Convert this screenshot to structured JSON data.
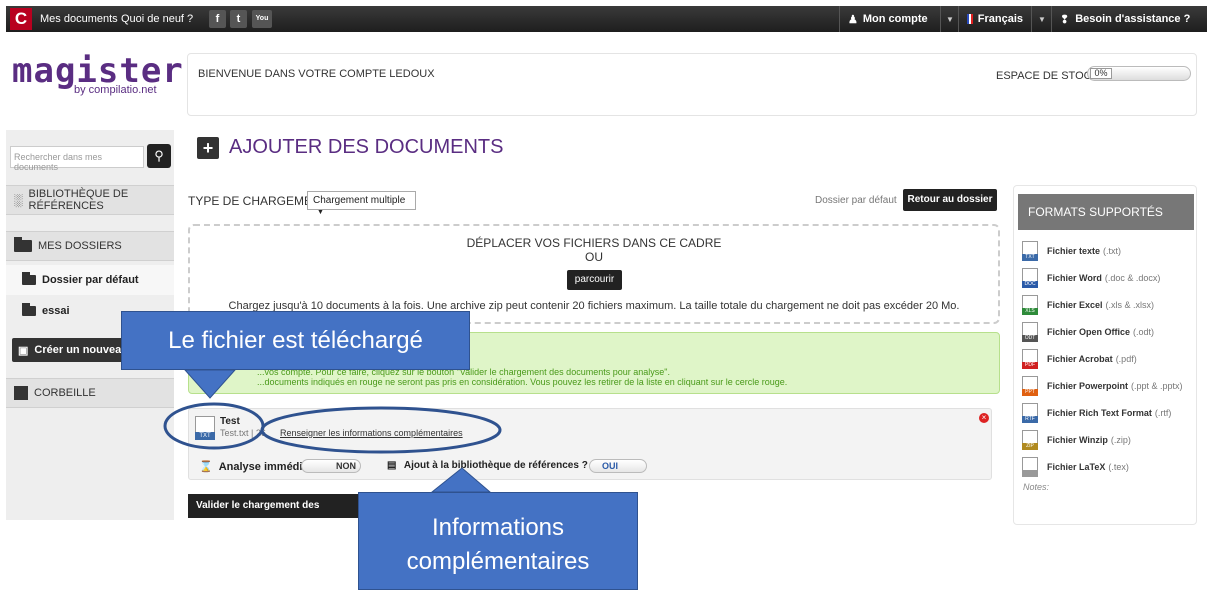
{
  "topbar": {
    "logo_letter": "C",
    "nav": [
      "Mes documents",
      "Quoi de neuf ?"
    ],
    "social": [
      "f",
      "t",
      "You"
    ],
    "account": "Mon compte",
    "language": "Français",
    "help": "Besoin d'assistance ?"
  },
  "brand": {
    "name": "magister",
    "by": "by compilatio.net"
  },
  "welcome": {
    "text": "BIENVENUE DANS VOTRE COMPTE LEDOUX",
    "storage_label": "ESPACE DE STOCKAGE",
    "storage_value": "0%",
    "storage_used": 0
  },
  "sidebar": {
    "search_placeholder": "Rechercher dans mes documents",
    "library": "BIBLIOTHÈQUE DE RÉFÉRENCES",
    "folders_header": "MES DOSSIERS",
    "folders": [
      "Dossier par défaut",
      "essai"
    ],
    "create_button": "Créer un nouveau",
    "trash": "CORBEILLE"
  },
  "main": {
    "title": "AJOUTER DES DOCUMENTS",
    "type_label": "TYPE DE CHARGEMENT",
    "type_value": "Chargement multiple",
    "default_folder": "Dossier par défaut",
    "back_button": "Retour au dossier",
    "dropzone": {
      "line1": "DÉPLACER VOS FICHIERS DANS CE CADRE",
      "line2": "OU",
      "browse": "parcourir",
      "line3": "Chargez jusqu'à 10 documents à la fois. Une archive zip peut contenir 20 fichiers maximum. La taille totale du chargement ne doit pas excéder 20 Mo."
    },
    "notice": {
      "line1": "...vos compte. Pour ce faire, cliquez sur le bouton \"Valider le chargement des documents pour analyse\".",
      "line2": "...documents indiqués en rouge ne seront pas pris en considération. Vous pouvez les retirer de la liste en cliquant sur le cercle rouge."
    },
    "file": {
      "name": "Test",
      "ext_label": "TXT",
      "meta": "Test.txt | 26",
      "link": "Renseigner les informations complémentaires",
      "analyse_label": "Analyse immédiate",
      "analyse_state": "NON",
      "library_label": "Ajout à la bibliothèque de références ?",
      "library_state": "OUI"
    },
    "validate_button": "Valider le chargement des documents"
  },
  "formats": {
    "header": "FORMATS SUPPORTÉS",
    "items": [
      {
        "name": "Fichier texte",
        "ext": "(.txt)",
        "tag": "TXT",
        "color": "#3b6aa8"
      },
      {
        "name": "Fichier Word",
        "ext": "(.doc & .docx)",
        "tag": "DOC",
        "color": "#2a5aa8"
      },
      {
        "name": "Fichier Excel",
        "ext": "(.xls & .xlsx)",
        "tag": "XLS",
        "color": "#2e8b3a"
      },
      {
        "name": "Fichier Open Office",
        "ext": "(.odt)",
        "tag": "ODT",
        "color": "#555555"
      },
      {
        "name": "Fichier Acrobat",
        "ext": "(.pdf)",
        "tag": "PDF",
        "color": "#d02020"
      },
      {
        "name": "Fichier Powerpoint",
        "ext": "(.ppt & .pptx)",
        "tag": "PPT",
        "color": "#e06010"
      },
      {
        "name": "Fichier Rich Text Format",
        "ext": "(.rtf)",
        "tag": "RTF",
        "color": "#3b6aa8"
      },
      {
        "name": "Fichier Winzip",
        "ext": "(.zip)",
        "tag": "ZIP",
        "color": "#b08a20"
      },
      {
        "name": "Fichier LaTeX",
        "ext": "(.tex)",
        "tag": "",
        "color": "#999999"
      }
    ],
    "notes": "Notes:"
  },
  "callouts": {
    "uploaded": "Le fichier est téléchargé",
    "info_line1": "Informations",
    "info_line2": "complémentaires"
  },
  "colors": {
    "brand_purple": "#5a2d82",
    "callout_blue": "#4472c4",
    "notice_green": "#dff5c8"
  }
}
